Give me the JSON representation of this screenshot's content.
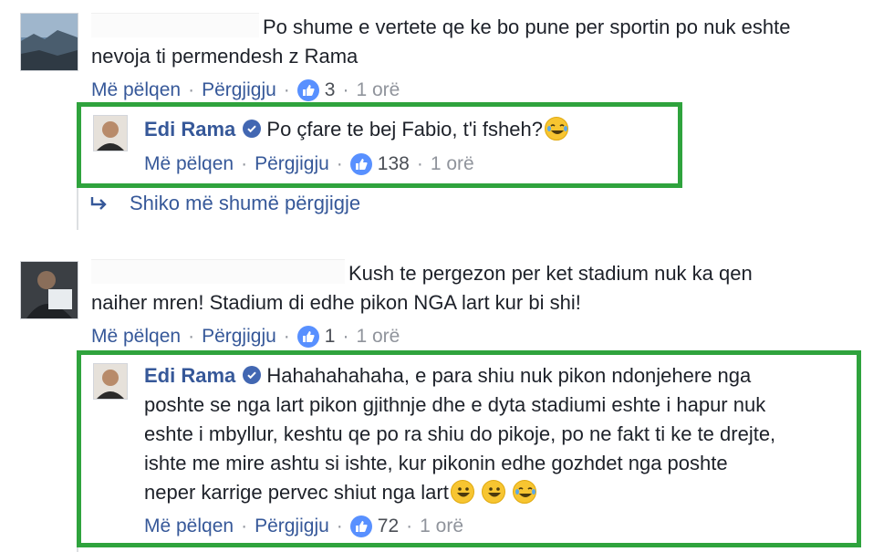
{
  "comments": [
    {
      "text": "Po shume e vertete qe ke bo pune per sportin po nuk eshte nevoja ti permendesh z Rama",
      "line1": "Po shume e vertete qe ke bo pune per sportin po nuk eshte",
      "line2": "nevoja ti permendesh z Rama",
      "like_label": "Më pëlqen",
      "reply_label": "Përgjigju",
      "likes": "3",
      "time": "1 orë",
      "reply": {
        "author": "Edi Rama",
        "text": "Po çfare te bej Fabio, t'i fsheh?",
        "like_label": "Më pëlqen",
        "reply_label": "Përgjigju",
        "likes": "138",
        "time": "1 orë"
      },
      "more_replies": "Shiko më shumë përgjigje"
    },
    {
      "line1": "Kush te pergezon per ket stadium nuk ka qen",
      "line2": "naiher mren! Stadium di edhe pikon NGA lart kur bi shi!",
      "like_label": "Më pëlqen",
      "reply_label": "Përgjigju",
      "likes": "1",
      "time": "1 orë",
      "reply": {
        "author": "Edi Rama",
        "line1": "Hahahahahaha, e para shiu nuk pikon ndonjehere nga",
        "line2": "poshte se nga lart pikon gjithnje dhe e dyta stadiumi eshte i hapur nuk",
        "line3": "eshte i mbyllur, keshtu qe po ra shiu do pikoje, po ne fakt ti ke te drejte,",
        "line4": "ishte me mire ashtu si ishte, kur pikonin edhe gozhdet nga poshte",
        "line5": "neper karrige pervec shiut nga lart",
        "like_label": "Më pëlqen",
        "reply_label": "Përgjigju",
        "likes": "72",
        "time": "1 orë"
      }
    }
  ],
  "colors": {
    "link": "#365899",
    "highlight_box": "#2fa33d",
    "like_badge": "#5890ff"
  }
}
